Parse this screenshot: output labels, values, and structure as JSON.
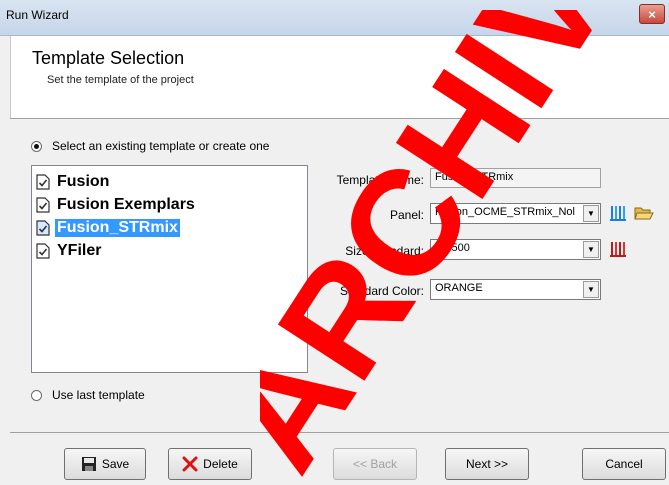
{
  "window": {
    "title": "Run Wizard",
    "close_glyph": "×"
  },
  "header": {
    "title": "Template Selection",
    "subtitle": "Set the template of the project"
  },
  "options": {
    "existing_label": "Select an existing template or create one",
    "last_label": "Use last template",
    "selected": "existing"
  },
  "templates": [
    {
      "label": "Fusion",
      "selected": false
    },
    {
      "label": "Fusion Exemplars",
      "selected": false
    },
    {
      "label": "Fusion_STRmix",
      "selected": true
    },
    {
      "label": "YFiler",
      "selected": false
    }
  ],
  "form": {
    "template_name_label": "Template Name:",
    "template_name_value": "Fusion_STRmix",
    "panel_label": "Panel:",
    "panel_value": "Fusion_OCME_STRmix_Nol",
    "size_standard_label": "Size Standard:",
    "size_standard_value": "ILS500",
    "standard_color_label": "Standard Color:",
    "standard_color_value": "ORANGE"
  },
  "buttons": {
    "save": "Save",
    "delete": "Delete",
    "back": "<< Back",
    "next": "Next >>",
    "cancel": "Cancel"
  },
  "watermark": {
    "text": "ARCHIVE",
    "color": "#ff0000"
  },
  "colors": {
    "selection": "#3399ff",
    "accent": "#3399ff"
  },
  "icons": {
    "panel_view": "blue-bars-icon",
    "open_folder": "open-folder-icon",
    "size_standard_view": "red-bars-icon",
    "save": "floppy-disk-icon",
    "delete": "red-x-icon",
    "template_item": "document-check-icon"
  }
}
